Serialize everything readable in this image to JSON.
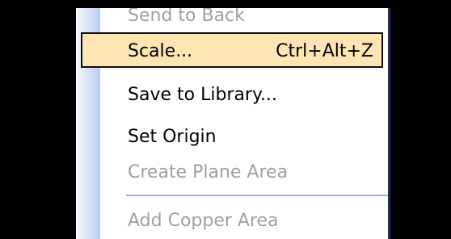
{
  "context_menu": {
    "items": [
      {
        "label": "Send to Back",
        "shortcut": "",
        "enabled": false
      },
      {
        "label": "Scale...",
        "shortcut": "Ctrl+Alt+Z",
        "enabled": true,
        "highlighted": true
      },
      {
        "label": "Save to Library...",
        "shortcut": "",
        "enabled": true
      },
      {
        "label": "Set Origin",
        "shortcut": "",
        "enabled": true
      },
      {
        "label": "Create Plane Area",
        "shortcut": "",
        "enabled": false
      },
      {
        "label": "Add Copper Area",
        "shortcut": "",
        "enabled": false
      }
    ],
    "highlight_color": "#fde6b3",
    "disabled_text_color": "#a0a0a0",
    "gutter_color": "#b9ccf4"
  }
}
